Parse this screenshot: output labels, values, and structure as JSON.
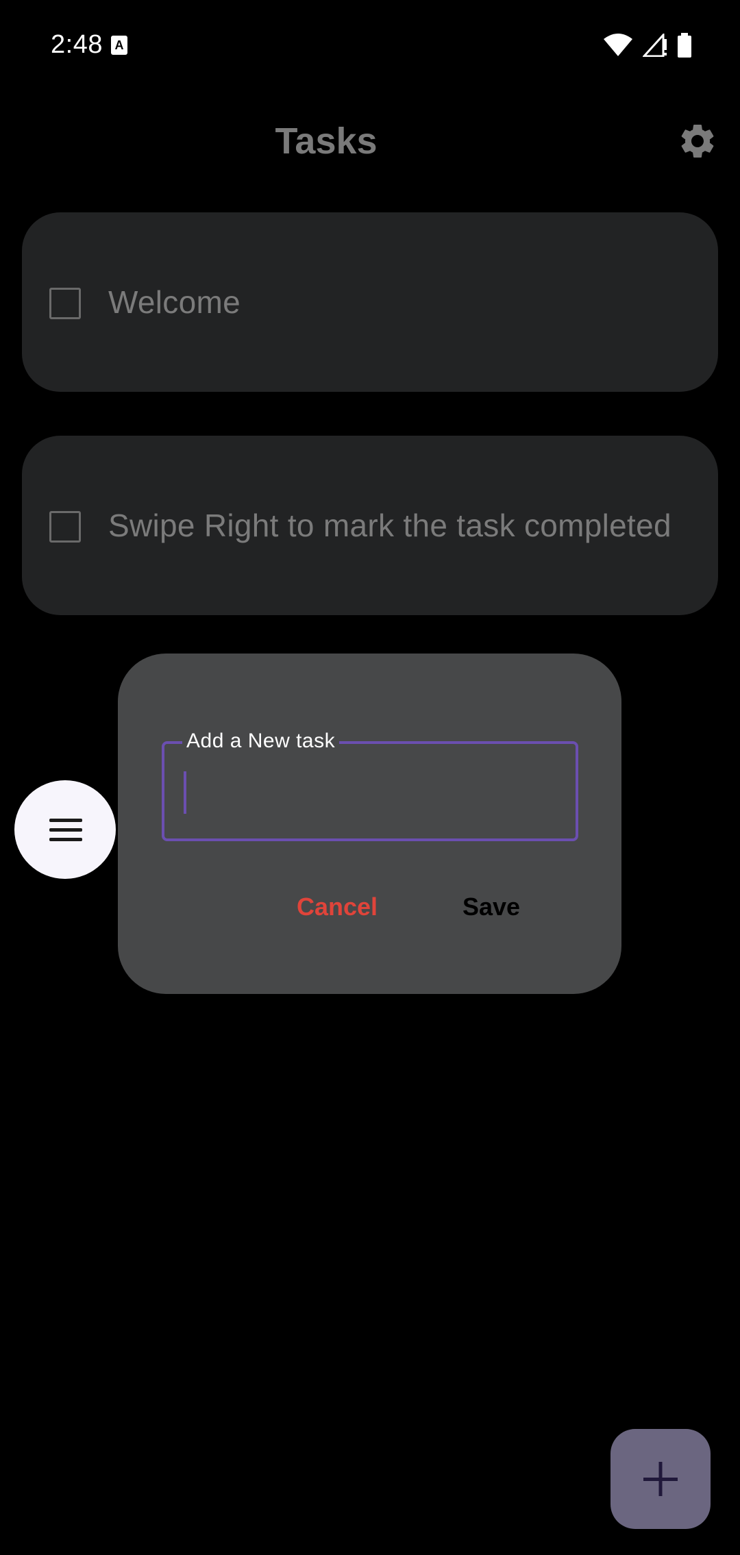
{
  "status_bar": {
    "time": "2:48",
    "notification_icon": "a-icon",
    "icons": [
      "wifi-icon",
      "signal-icon",
      "battery-icon"
    ]
  },
  "app_bar": {
    "title": "Tasks",
    "settings_icon": "gear-icon"
  },
  "tasks": [
    {
      "label": "Welcome",
      "checked": false
    },
    {
      "label": "Swipe Right to mark the task completed",
      "checked": false
    }
  ],
  "dialog": {
    "field_label": "Add a New task",
    "field_value": "",
    "cancel_label": "Cancel",
    "save_label": "Save"
  },
  "menu_button": {
    "icon": "menu-icon"
  },
  "fab": {
    "icon": "plus-icon"
  },
  "colors": {
    "accent": "#6b4fb0",
    "cancel": "#e0443a",
    "card": "#222324",
    "dialog": "#474849"
  }
}
